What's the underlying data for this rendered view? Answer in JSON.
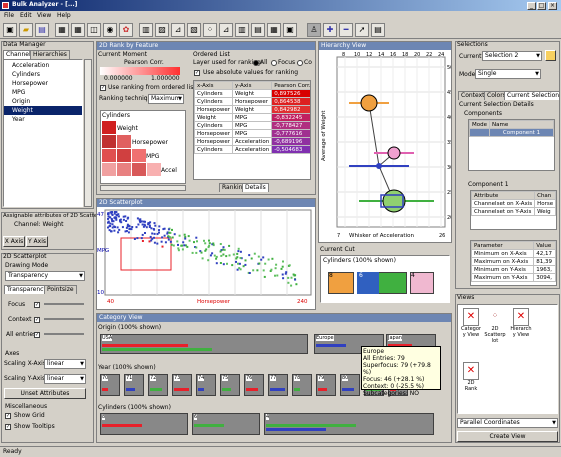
{
  "title_bar": {
    "title": "Bulk Analyzer - [...]"
  },
  "menu": {
    "file": "File",
    "edit": "Edit",
    "view": "View",
    "help": "Help"
  },
  "status": {
    "text": "Ready"
  },
  "data_manager": {
    "title": "Data Manager",
    "tab_channels": "Channels",
    "tab_hierarchies": "Hierarchies",
    "channels": [
      "Acceleration",
      "Cylinders",
      "Horsepower",
      "MPG",
      "Origin",
      "Weight",
      "Year"
    ],
    "selected_index": 6
  },
  "assignable": {
    "title": "Assignable attributes of 2D Scatter",
    "channel": "Channel: Weight",
    "x_btn": "X Axis",
    "y_btn": "Y Axis"
  },
  "scatter_settings": {
    "title": "2D Scatterplot",
    "drawing_mode_label": "Drawing Mode",
    "drawing_mode": "Transparency",
    "tab_transparency": "Transparency",
    "tab_pointsize": "Pointsize",
    "focus": "Focus",
    "context": "Context",
    "all_entries": "All entries",
    "axes_label": "Axes",
    "scaling_x_label": "Scaling X-Axis",
    "scaling_x": "linear",
    "scaling_y_label": "Scaling Y-Axis",
    "scaling_y": "linear",
    "unset_btn": "Unset Attributes",
    "misc_label": "Miscellaneous",
    "show_grid": "Show Grid",
    "show_tooltips": "Show Tooltips"
  },
  "rank": {
    "title": "2D Rank by Feature",
    "current_moment": "Current Moment",
    "pearson": "Pearson Corr.",
    "min": "0.000000",
    "max": "1.000000",
    "use_ranking": "Use ranking from ordered list",
    "ranking_technique_label": "Ranking technique:",
    "ranking_technique": "Maximum",
    "matrix_labels": [
      "Cylinders",
      "Weight",
      "Horsepower",
      "MPG",
      "Accel"
    ]
  },
  "ordered_list": {
    "title": "Ordered List",
    "layer_label": "Layer used for ranking:",
    "opt_all": "All",
    "opt_focus": "Focus",
    "opt_co": "Co",
    "use_abs": "Use absolute values for ranking",
    "col_x": "x-Axis",
    "col_y": "y-Axis",
    "col_p": "Pearson Corr.",
    "rows": [
      [
        "Cylinders",
        "Weight",
        "0,897526"
      ],
      [
        "Cylinders",
        "Horsepower",
        "0,864538"
      ],
      [
        "Horsepower",
        "Weight",
        "0,842982"
      ],
      [
        "Weight",
        "MPG",
        "-0,832245"
      ],
      [
        "Cylinders",
        "MPG",
        "-0,778427"
      ],
      [
        "Horsepower",
        "MPG",
        "-0,777616"
      ],
      [
        "Horsepower",
        "Acceleration",
        "-0,689196"
      ],
      [
        "Cylinders",
        "Acceleration",
        "-0,504683"
      ]
    ],
    "tab_ranking": "Ranking",
    "tab_details": "Details"
  },
  "hierarchy": {
    "title": "Hierarchy View",
    "ylabel": "Average of Weight",
    "xlabel": "Whisker of Acceleration",
    "yticks": [
      "5000",
      "4500",
      "4000",
      "3500",
      "3000",
      "2500",
      "2000"
    ],
    "xticks": [
      "8",
      "10",
      "12",
      "14",
      "16",
      "18",
      "20",
      "22",
      "24"
    ],
    "x_min": "7",
    "x_max": "26",
    "current_cut": "Current Cut",
    "cut_label": "Cylinders (100% shown)",
    "cut_nums": [
      "8",
      "6",
      "4"
    ]
  },
  "scatter": {
    "title": "2D Scatterplot",
    "xlabel": "Horsepower",
    "ylabel": "MPG",
    "x_min": "40",
    "x_max": "240",
    "y_top": "47",
    "y_bot": "10"
  },
  "category": {
    "title": "Category View",
    "origin_label": "Origin (100% shown)",
    "origins": [
      "USA",
      "Europe",
      "Japan"
    ],
    "year_label": "Year (100% shown)",
    "years": [
      "70",
      "71",
      "72",
      "73",
      "74",
      "75",
      "76",
      "77",
      "78",
      "79",
      "80",
      "81",
      "82"
    ],
    "cyl_label": "Cylinders (100% shown)",
    "cyls": [
      "8",
      "6",
      "4"
    ],
    "tooltip": [
      "Europe",
      "All Entries: 79",
      "Superfocus: 79 (+79.8 %)",
      "Focus: 46 (+28.1 %)",
      "Context: 0 (-25.5 %)",
      "Subcategories: NO"
    ]
  },
  "selections": {
    "title": "Selections",
    "current_label": "Current:",
    "current": "Selection 2",
    "mode_label": "Mode:",
    "mode": "Single",
    "tab_context": "Context",
    "tab_colors": "Colors",
    "tab_csd": "Current Selection Data",
    "csd_label": "Current Selection Details",
    "components_label": "Components",
    "col_mode": "Mode",
    "col_name": "Name",
    "comp_row": "Component 1",
    "comp1_label": "Component 1",
    "col_attr": "Attribute",
    "col_chan": "Chan",
    "attr_rows": [
      [
        "Channelset on X-Axis",
        "Horse"
      ],
      [
        "Channelset on Y-Axis",
        "Weig"
      ]
    ],
    "col_param": "Parameter",
    "col_value": "Value",
    "param_rows": [
      [
        "Minimum on X-Axis",
        "42,17"
      ],
      [
        "Maximum on X-Axis",
        "81,39"
      ],
      [
        "Minimum on Y-Axis",
        "1963,"
      ],
      [
        "Maximum on Y-Axis",
        "3094,"
      ]
    ]
  },
  "views": {
    "title": "Views",
    "items": [
      "Category View",
      "2D Scatterplot",
      "Hierarchy View",
      "2D Rank"
    ],
    "parallel": "Parallel Coordinates",
    "create_btn": "Create View"
  },
  "colors": {
    "title_bar": "#0a246a",
    "panel_header": "#6d86b3",
    "red": "#e8202a",
    "blue": "#3040c0",
    "green": "#40b040",
    "pink": "#f0a0c0",
    "orange": "#f0a040",
    "selection": "#0a246a"
  }
}
